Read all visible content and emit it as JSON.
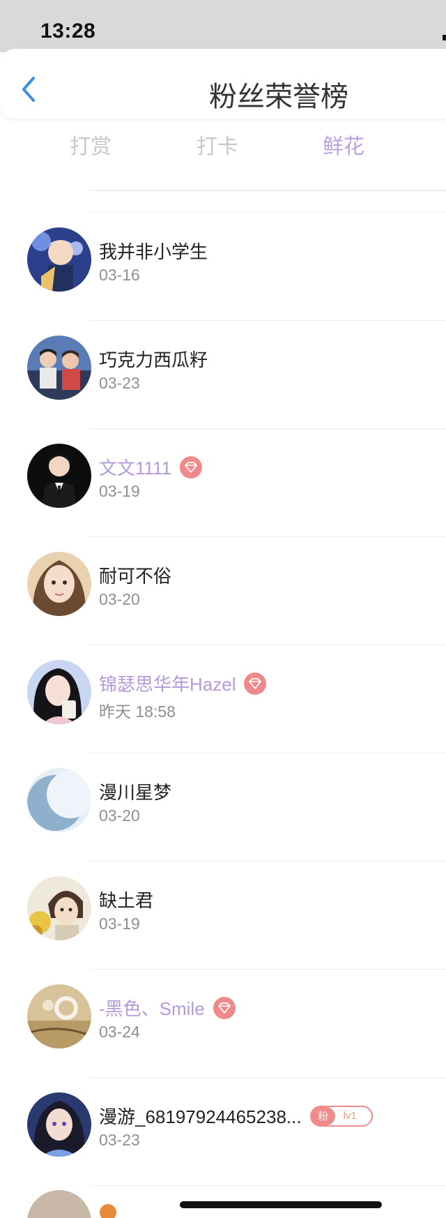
{
  "status_bar": {
    "time": "13:28"
  },
  "header": {
    "title": "粉丝荣誉榜"
  },
  "tabs": [
    {
      "label": "打赏",
      "active": false
    },
    {
      "label": "打卡",
      "active": false
    },
    {
      "label": "鲜花",
      "active": true
    }
  ],
  "colors": {
    "accent": "#b8a3dc",
    "vip_name": "#b49ad8",
    "badge": "#f08a8a",
    "back": "#3a8ee6"
  },
  "fans": [
    {
      "name": "我并非小学生",
      "date": "03-16",
      "vip": false,
      "avatar": "anime-boy-blue"
    },
    {
      "name": "巧克力西瓜籽",
      "date": "03-23",
      "vip": false,
      "avatar": "two-people"
    },
    {
      "name": "文文1111",
      "date": "03-19",
      "vip": true,
      "avatar": "man-in-suit"
    },
    {
      "name": "耐可不俗",
      "date": "03-20",
      "vip": false,
      "avatar": "girl-portrait"
    },
    {
      "name": "锦瑟思华年Hazel",
      "date": "昨天 18:58",
      "vip": true,
      "avatar": "girl-with-cup"
    },
    {
      "name": "漫川星梦",
      "date": "03-20",
      "vip": false,
      "avatar": "moon"
    },
    {
      "name": "缺土君",
      "date": "03-19",
      "vip": false,
      "avatar": "cartoon-boy"
    },
    {
      "name": "-黑色、Smile",
      "date": "03-24",
      "vip": true,
      "avatar": "ring-still-life"
    },
    {
      "name": "漫游_68197924465238...",
      "date": "03-23",
      "vip": false,
      "avatar": "anime-girl",
      "fan_badge": {
        "tag": "粉",
        "level": "lv1"
      }
    }
  ]
}
